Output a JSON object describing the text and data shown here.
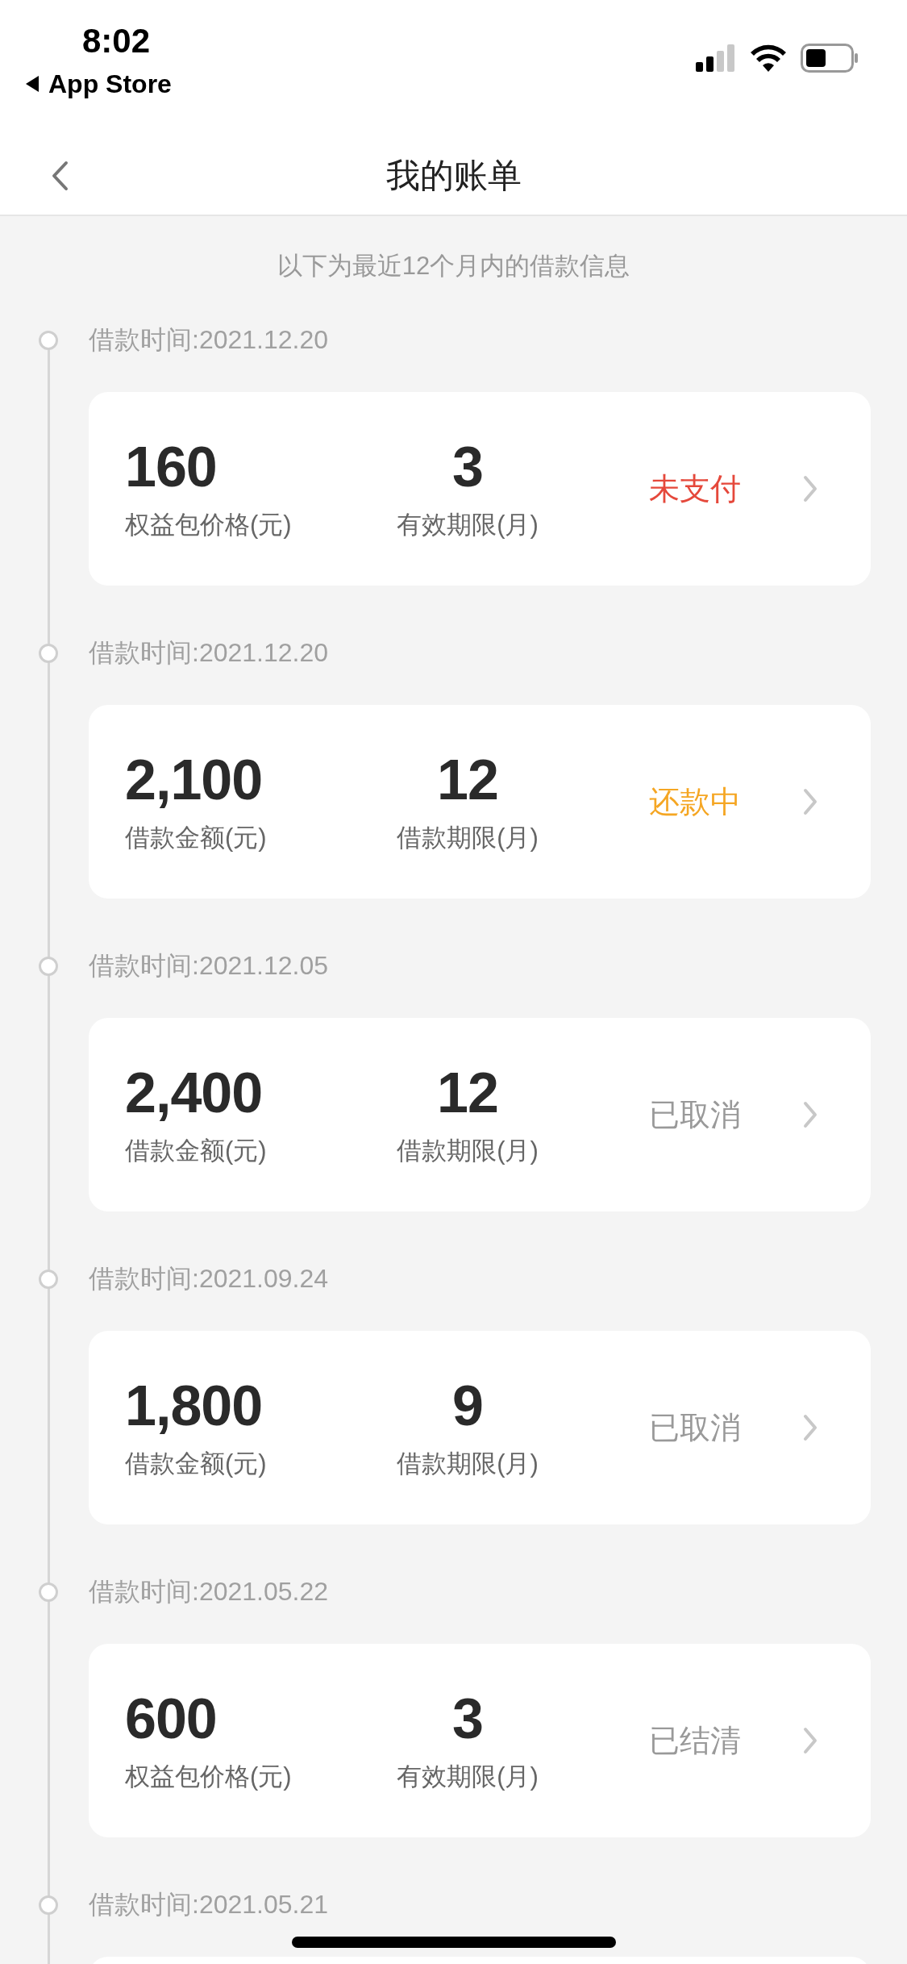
{
  "status_bar": {
    "time": "8:02",
    "back_app": "App Store"
  },
  "nav": {
    "title": "我的账单"
  },
  "subtitle": "以下为最近12个月内的借款信息",
  "entries": [
    {
      "date": "借款时间:2021.12.20",
      "amount": "160",
      "amount_label": "权益包价格(元)",
      "term": "3",
      "term_label": "有效期限(月)",
      "status": "未支付",
      "color": "#e5483b"
    },
    {
      "date": "借款时间:2021.12.20",
      "amount": "2,100",
      "amount_label": "借款金额(元)",
      "term": "12",
      "term_label": "借款期限(月)",
      "status": "还款中",
      "color": "#f5a623"
    },
    {
      "date": "借款时间:2021.12.05",
      "amount": "2,400",
      "amount_label": "借款金额(元)",
      "term": "12",
      "term_label": "借款期限(月)",
      "status": "已取消",
      "color": "#999999"
    },
    {
      "date": "借款时间:2021.09.24",
      "amount": "1,800",
      "amount_label": "借款金额(元)",
      "term": "9",
      "term_label": "借款期限(月)",
      "status": "已取消",
      "color": "#999999"
    },
    {
      "date": "借款时间:2021.05.22",
      "amount": "600",
      "amount_label": "权益包价格(元)",
      "term": "3",
      "term_label": "有效期限(月)",
      "status": "已结清",
      "color": "#999999"
    },
    {
      "date": "借款时间:2021.05.21"
    }
  ]
}
